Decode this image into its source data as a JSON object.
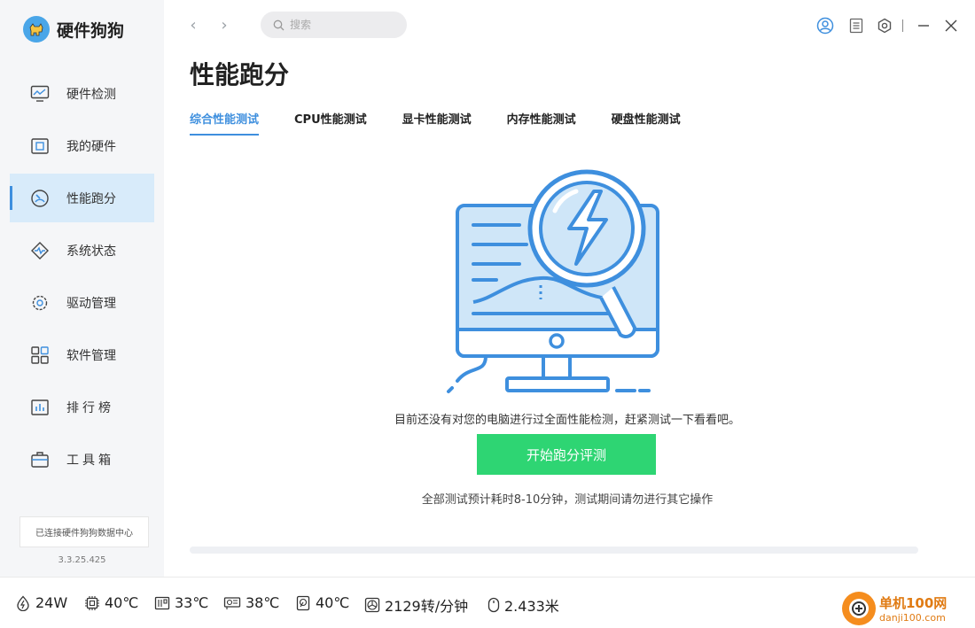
{
  "app": {
    "title": "硬件狗狗"
  },
  "sidebar": {
    "items": [
      {
        "label": "硬件检测",
        "icon": "monitor-chart-icon"
      },
      {
        "label": "我的硬件",
        "icon": "chip-board-icon"
      },
      {
        "label": "性能跑分",
        "icon": "speedometer-icon",
        "active": true
      },
      {
        "label": "系统状态",
        "icon": "pulse-icon"
      },
      {
        "label": "驱动管理",
        "icon": "gear-icon"
      },
      {
        "label": "软件管理",
        "icon": "apps-grid-icon"
      },
      {
        "label": "排行榜",
        "icon": "bar-chart-icon"
      },
      {
        "label": "工具箱",
        "icon": "toolbox-icon"
      }
    ],
    "connect_status": "已连接硬件狗狗数据中心",
    "version": "3.3.25.425"
  },
  "topbar": {
    "search_placeholder": "搜索"
  },
  "main": {
    "title": "性能跑分",
    "tabs": [
      {
        "label": "综合性能测试",
        "active": true
      },
      {
        "label": "CPU性能测试"
      },
      {
        "label": "显卡性能测试"
      },
      {
        "label": "内存性能测试"
      },
      {
        "label": "硬盘性能测试"
      }
    ],
    "empty_message": "目前还没有对您的电脑进行过全面性能检测，赶紧测试一下看看吧。",
    "start_button": "开始跑分评测",
    "hint": "全部测试预计耗时8-10分钟，测试期间请勿进行其它操作",
    "progress": 0
  },
  "status": {
    "power": "24W",
    "cpu_temp": "40℃",
    "board_temp": "33℃",
    "gpu_temp": "38℃",
    "disk_temp": "40℃",
    "fan_speed": "2129转/分钟",
    "mouse_distance": "2.433米"
  },
  "watermark": {
    "name": "单机100网",
    "url": "danji100.com"
  },
  "colors": {
    "accent": "#3e8fde",
    "start_button": "#2ed573",
    "active_nav_bg": "#d8ebfa"
  }
}
